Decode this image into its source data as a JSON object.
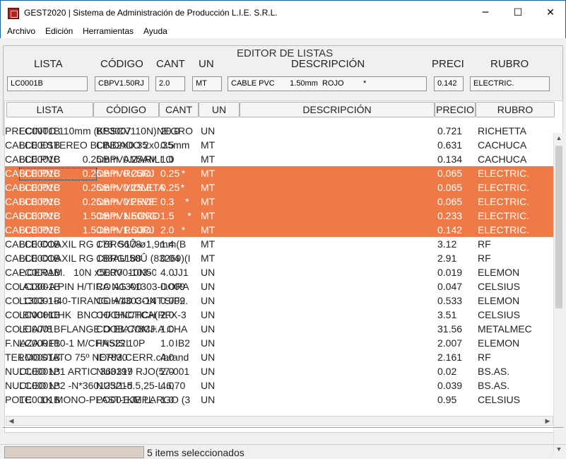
{
  "window": {
    "title": "GEST2020 | Sistema de Administración de Producción L.I.E. S.R.L.",
    "minimize_glyph": "─",
    "maximize_glyph": "☐",
    "close_glyph": "✕"
  },
  "menu": [
    "Archivo",
    "Edición",
    "Herramientas",
    "Ayuda"
  ],
  "editor": {
    "title": "EDITOR DE LISTAS",
    "labels": {
      "lista": "LISTA",
      "codigo": "CÓDIGO",
      "cant": "CANT",
      "un": "UN",
      "descripcion": "DESCRIPCIÓN",
      "precio": "PRECI",
      "rubro": "RUBRO"
    },
    "values": {
      "lista": "LC0001B",
      "codigo": "CBPV1.50RJ",
      "cant": "2.0",
      "un": "MT",
      "descripcion": "CABLE PVC       1.50mm  ROJO         *",
      "precio": "0.142",
      "rubro": "ELECTRIC."
    }
  },
  "grid": {
    "columns": [
      "LISTA",
      "CÓDIGO",
      "CANT",
      "UN",
      "DESCRIPCIÓN",
      "PRECIO",
      "RUBRO"
    ],
    "rows": [
      {
        "lista": "LC0001B",
        "codigo": "BP3007",
        "cant": "20.0",
        "un": "UN",
        "descripcion": "PRECINTO 110mm (KSSCV110N)NEGRO",
        "precio": "0.721",
        "rubro": "RICHETTA",
        "selected": false
      },
      {
        "lista": "LC0001B",
        "codigo": "CBB2X0.35",
        "cant": "0.5",
        "un": "MT",
        "descripcion": "CABLE ESTEREO BLINDADO 2x0.35mm",
        "precio": "0.631",
        "rubro": "CACHUCA",
        "selected": false
      },
      {
        "lista": "LC0001B",
        "codigo": "CBPV0.25AM",
        "cant": "1.0",
        "un": "MT",
        "descripcion": "CABLE PVC        0.25mm  AMARILLO",
        "precio": "0.134",
        "rubro": "CACHUCA",
        "selected": false
      },
      {
        "lista": "LC0001B",
        "codigo": "CBPV0.25RJ",
        "cant": "0.25",
        "un": "MT",
        "descripcion": "CABLE PVC        0.25mm  ROJO           *",
        "precio": "0.065",
        "rubro": "ELECTRIC.",
        "selected": true
      },
      {
        "lista": "LC0001B",
        "codigo": "CBPV0.25VL",
        "cant": "0.25",
        "un": "MT",
        "descripcion": "CABLE PVC        0.25mm  VIOLETA      *",
        "precio": "0.065",
        "rubro": "ELECTRIC.",
        "selected": true
      },
      {
        "lista": "LC0001B",
        "codigo": "CBPV0.25VE",
        "cant": "0.3",
        "un": "MT",
        "descripcion": "CABLE PVC        0.25mm  VERDE          *",
        "precio": "0.065",
        "rubro": "ELECTRIC.",
        "selected": true
      },
      {
        "lista": "LC0001B",
        "codigo": "CBPV1.50NG",
        "cant": "1.5",
        "un": "MT",
        "descripcion": "CABLE PVC        1.50mm  NEGRO          *",
        "precio": "0.233",
        "rubro": "ELECTRIC.",
        "selected": true
      },
      {
        "lista": "LC0001B",
        "codigo": "CBPV1.50RJ",
        "cant": "2.0",
        "un": "MT",
        "descripcion": "CABLE PVC        1.50mm  ROJO           *",
        "precio": "0.142",
        "rubro": "ELECTRIC.",
        "selected": true
      },
      {
        "lista": "LC0001B",
        "codigo": "CBRG178",
        "cant": "1.4",
        "un": "MT",
        "descripcion": "CABLE COAXIL RG 178  56Û-ø1,9mm(B",
        "precio": "3.12",
        "rubro": "RF",
        "selected": false
      },
      {
        "lista": "LC0001B",
        "codigo": "CBRG188",
        "cant": "0.04",
        "un": "MT",
        "descripcion": "CABLE COAXIL RG 188AU 50Û (83269)(I",
        "precio": "2.91",
        "rubro": "RF",
        "selected": false
      },
      {
        "lista": "LC0001B",
        "codigo": "CER0010N50",
        "cant": "4.0",
        "un": "UN",
        "descripcion": "CAP.CERAM.   10N x500V  -103-        JJ1",
        "precio": "0.019",
        "rubro": "ELEMON",
        "selected": false
      },
      {
        "lista": "LC0001B",
        "codigo": "CO A1300",
        "cant": "0.009",
        "un": "UN",
        "descripcion": "CO.A130-A PIN H/TIRA NG A1303-DORA",
        "precio": "0.047",
        "rubro": "CELSIUS",
        "selected": false
      },
      {
        "lista": "LC0001B",
        "codigo": "CO A1303-140",
        "cant": "0.009",
        "un": "UN",
        "descripcion": "CO.1303-1-40-TIRANG.H/40 CONT.S/F2.",
        "precio": "0.533",
        "rubro": "ELEMON",
        "selected": false
      },
      {
        "lista": "LC0001B",
        "codigo": "CO BNCHCHK",
        "cant": "2.0",
        "un": "UN",
        "descripcion": "CO.BNCHCHK  BNC H/CHC/TCA(RFX-3",
        "precio": "3.51",
        "rubro": "CELSIUS",
        "selected": false
      },
      {
        "lista": "LC0001B",
        "codigo": "CO EIA7/8CH",
        "cant": "1.0",
        "un": "UN",
        "descripcion": "CO.EIA7/8   FLANGE DOB.COMJ.A CHA",
        "precio": "31.56",
        "rubro": "METALMEC",
        "selected": false
      },
      {
        "lista": "LC0001B",
        "codigo": "FN522L",
        "cant": "1.0",
        "un": "UN",
        "descripcion": "F.NAZA RF10-1 M/CHASIS 10P           IB2",
        "precio": "2.007",
        "rubro": "ELEMON",
        "selected": false
      },
      {
        "lista": "LC0001B",
        "codigo": "IE7830",
        "cant": "4.0",
        "un": "UN",
        "descripcion": "TERMOSTATO 75º NORM.CERR.c/arand",
        "precio": "2.161",
        "rubro": "RF",
        "selected": false
      },
      {
        "lista": "LC0001B",
        "codigo": "NU3197",
        "cant": "2.0",
        "un": "UN",
        "descripcion": "NUCLEO N*1 ARTIC 360319 RJO(57-001",
        "precio": "0.02",
        "rubro": "BS.AS.",
        "selected": false
      },
      {
        "lista": "LC0001B",
        "codigo": "NU3215",
        "cant": "4.0",
        "un": "UN",
        "descripcion": "NUCLEO N*2 -N*360125/1-d.5,25-L.6,70",
        "precio": "0.039",
        "rubro": "BS.AS.",
        "selected": false
      },
      {
        "lista": "LC0001B",
        "codigo": "PO001KMPL",
        "cant": "1.0",
        "un": "UN",
        "descripcion": "POTE   1K MONO-PLAST-EJE LARGO (3",
        "precio": "0.95",
        "rubro": "CELSIUS",
        "selected": false
      }
    ]
  },
  "status": {
    "text": "5 items seleccionados",
    "progress": 0
  },
  "colors": {
    "selection": "#ee7a48",
    "title_accent": "#1a5fb4"
  }
}
